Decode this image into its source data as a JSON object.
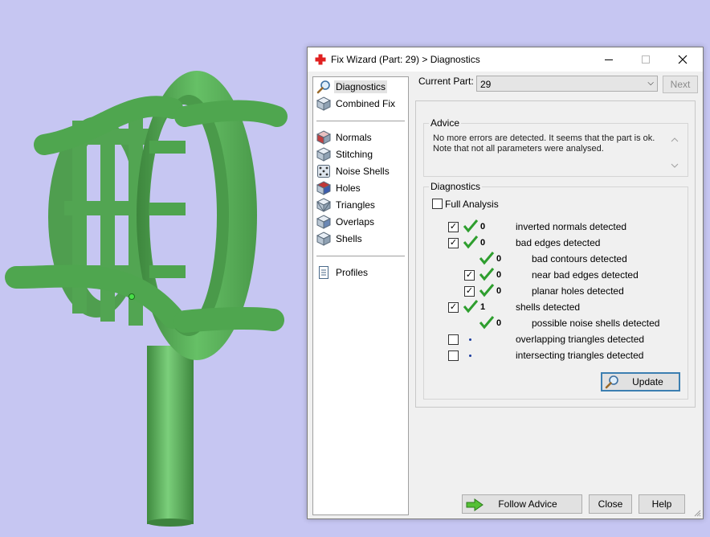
{
  "window": {
    "title": "Fix Wizard (Part: 29) > Diagnostics",
    "icon": "red-cross-icon"
  },
  "sidebar": {
    "items": [
      {
        "label": "Diagnostics",
        "icon": "magnifier-icon",
        "selected": true
      },
      {
        "label": "Combined Fix",
        "icon": "cube-icon"
      },
      {
        "label": "Normals",
        "icon": "cube-red-icon"
      },
      {
        "label": "Stitching",
        "icon": "cube-icon"
      },
      {
        "label": "Noise Shells",
        "icon": "dice-icon"
      },
      {
        "label": "Holes",
        "icon": "cube-hole-icon"
      },
      {
        "label": "Triangles",
        "icon": "cube-triangles-icon"
      },
      {
        "label": "Overlaps",
        "icon": "cube-overlap-icon"
      },
      {
        "label": "Shells",
        "icon": "cube-icon"
      },
      {
        "label": "Profiles",
        "icon": "document-icon"
      }
    ]
  },
  "current_part": {
    "label": "Current Part:",
    "value": "29",
    "next_label": "Next"
  },
  "advice": {
    "title": "Advice",
    "text_line1": "No more errors are detected. It seems that the part is ok.",
    "text_line2": "Note that not all parameters were analysed."
  },
  "diagnostics": {
    "title": "Diagnostics",
    "full_analysis_label": "Full Analysis",
    "full_analysis_checked": false,
    "rows": [
      {
        "checkbox": true,
        "checked": true,
        "status": "ok",
        "value": "0",
        "label": "inverted normals detected"
      },
      {
        "checkbox": true,
        "checked": true,
        "status": "ok",
        "value": "0",
        "label": "bad edges detected"
      },
      {
        "checkbox": false,
        "status": "ok",
        "value": "0",
        "label": "bad contours detected"
      },
      {
        "checkbox": true,
        "checked": true,
        "status": "ok",
        "value": "0",
        "label": "near bad edges detected"
      },
      {
        "checkbox": true,
        "checked": true,
        "status": "ok",
        "value": "0",
        "label": "planar holes detected"
      },
      {
        "checkbox": true,
        "checked": true,
        "status": "ok",
        "value": "1",
        "label": "shells detected"
      },
      {
        "checkbox": false,
        "status": "ok",
        "value": "0",
        "label": "possible noise shells detected"
      },
      {
        "checkbox": true,
        "checked": false,
        "status": "pending",
        "value": "",
        "label": "overlapping triangles detected"
      },
      {
        "checkbox": true,
        "checked": false,
        "status": "pending",
        "value": "",
        "label": "intersecting triangles detected"
      }
    ],
    "update_label": "Update"
  },
  "footer": {
    "follow_advice_label": "Follow Advice",
    "close_label": "Close",
    "help_label": "Help"
  },
  "colors": {
    "background": "#c6c6f2",
    "part_green": "#5ab35a",
    "check_green": "#2e9e2e",
    "accent_blue": "#3c7fb1"
  }
}
